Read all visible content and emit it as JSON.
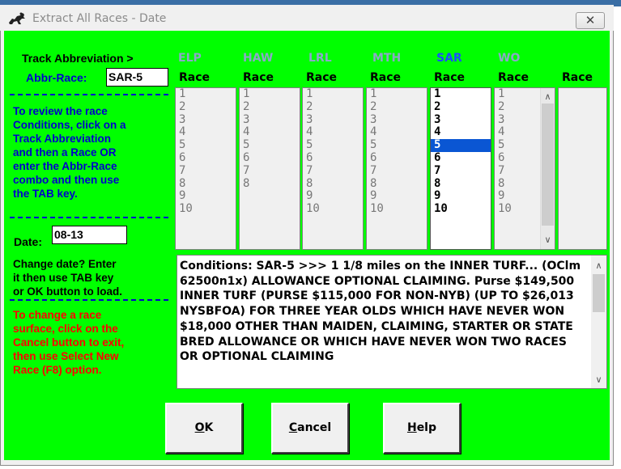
{
  "window": {
    "title": "Extract All Races - Date",
    "close_glyph": "✕"
  },
  "left": {
    "track_label": "Track Abbreviation >",
    "abbr_label": "Abbr-Race:",
    "abbr_value": "SAR-5",
    "review_note": "To review the race\nConditions, click on a\nTrack Abbreviation\nand then a Race OR\nenter the Abbr-Race\ncombo and then use\nthe TAB key.",
    "date_label": "Date:",
    "date_value": "08-13",
    "date_note": "Change date? Enter\nit then use TAB key\nor OK button to load.",
    "surface_note": "To change a race\nsurface, click on the\nCancel button to exit,\nthen use Select New\nRace (F8) option."
  },
  "tracks": [
    {
      "abbr": "ELP",
      "header": "Race",
      "races": [
        "1",
        "2",
        "3",
        "4",
        "5",
        "6",
        "7",
        "8",
        "9",
        "10"
      ],
      "active": false
    },
    {
      "abbr": "HAW",
      "header": "Race",
      "races": [
        "1",
        "2",
        "3",
        "4",
        "5",
        "6",
        "7",
        "8"
      ],
      "active": false
    },
    {
      "abbr": "LRL",
      "header": "Race",
      "races": [
        "1",
        "2",
        "3",
        "4",
        "5",
        "6",
        "7",
        "8",
        "9",
        "10"
      ],
      "active": false
    },
    {
      "abbr": "MTH",
      "header": "Race",
      "races": [
        "1",
        "2",
        "3",
        "4",
        "5",
        "6",
        "7",
        "8",
        "9",
        "10"
      ],
      "active": false
    },
    {
      "abbr": "SAR",
      "header": "Race",
      "races": [
        "1",
        "2",
        "3",
        "4",
        "5",
        "6",
        "7",
        "8",
        "9",
        "10"
      ],
      "active": true,
      "selected": "5"
    },
    {
      "abbr": "WO",
      "header": "Race",
      "races": [
        "1",
        "2",
        "3",
        "4",
        "5",
        "6",
        "7",
        "8",
        "9",
        "10"
      ],
      "active": false,
      "scrollbar": true
    },
    {
      "abbr": "",
      "header": "Race",
      "races": [],
      "active": false
    }
  ],
  "conditions": {
    "text": "Conditions: SAR-5 >>> 1 1/8 miles on the INNER TURF... (OClm 62500n1x) ALLOWANCE OPTIONAL CLAIMING. Purse $149,500 INNER TURF (PURSE $115,000 FOR NON-NYB) (UP TO $26,013 NYSBFOA) FOR THREE YEAR OLDS WHICH HAVE NEVER WON $18,000 OTHER THAN MAIDEN, CLAIMING, STARTER OR STATE BRED ALLOWANCE OR WHICH HAVE NEVER WON TWO RACES OR OPTIONAL CLAIMING"
  },
  "buttons": {
    "ok_key": "O",
    "ok_rest": "K",
    "cancel_key": "C",
    "cancel_rest": "ancel",
    "help_key": "H",
    "help_rest": "elp"
  },
  "colors": {
    "client_bg": "#00ff00",
    "blue_text": "#0000cc",
    "red_text": "#ff0000",
    "active_track": "#1a4fff",
    "inactive_track": "#8ba8c8",
    "selection": "#0a56d3"
  },
  "icons": {
    "title_icon": "horse-racing-icon",
    "up_arrow": "chevron-up-icon",
    "down_arrow": "chevron-down-icon"
  }
}
